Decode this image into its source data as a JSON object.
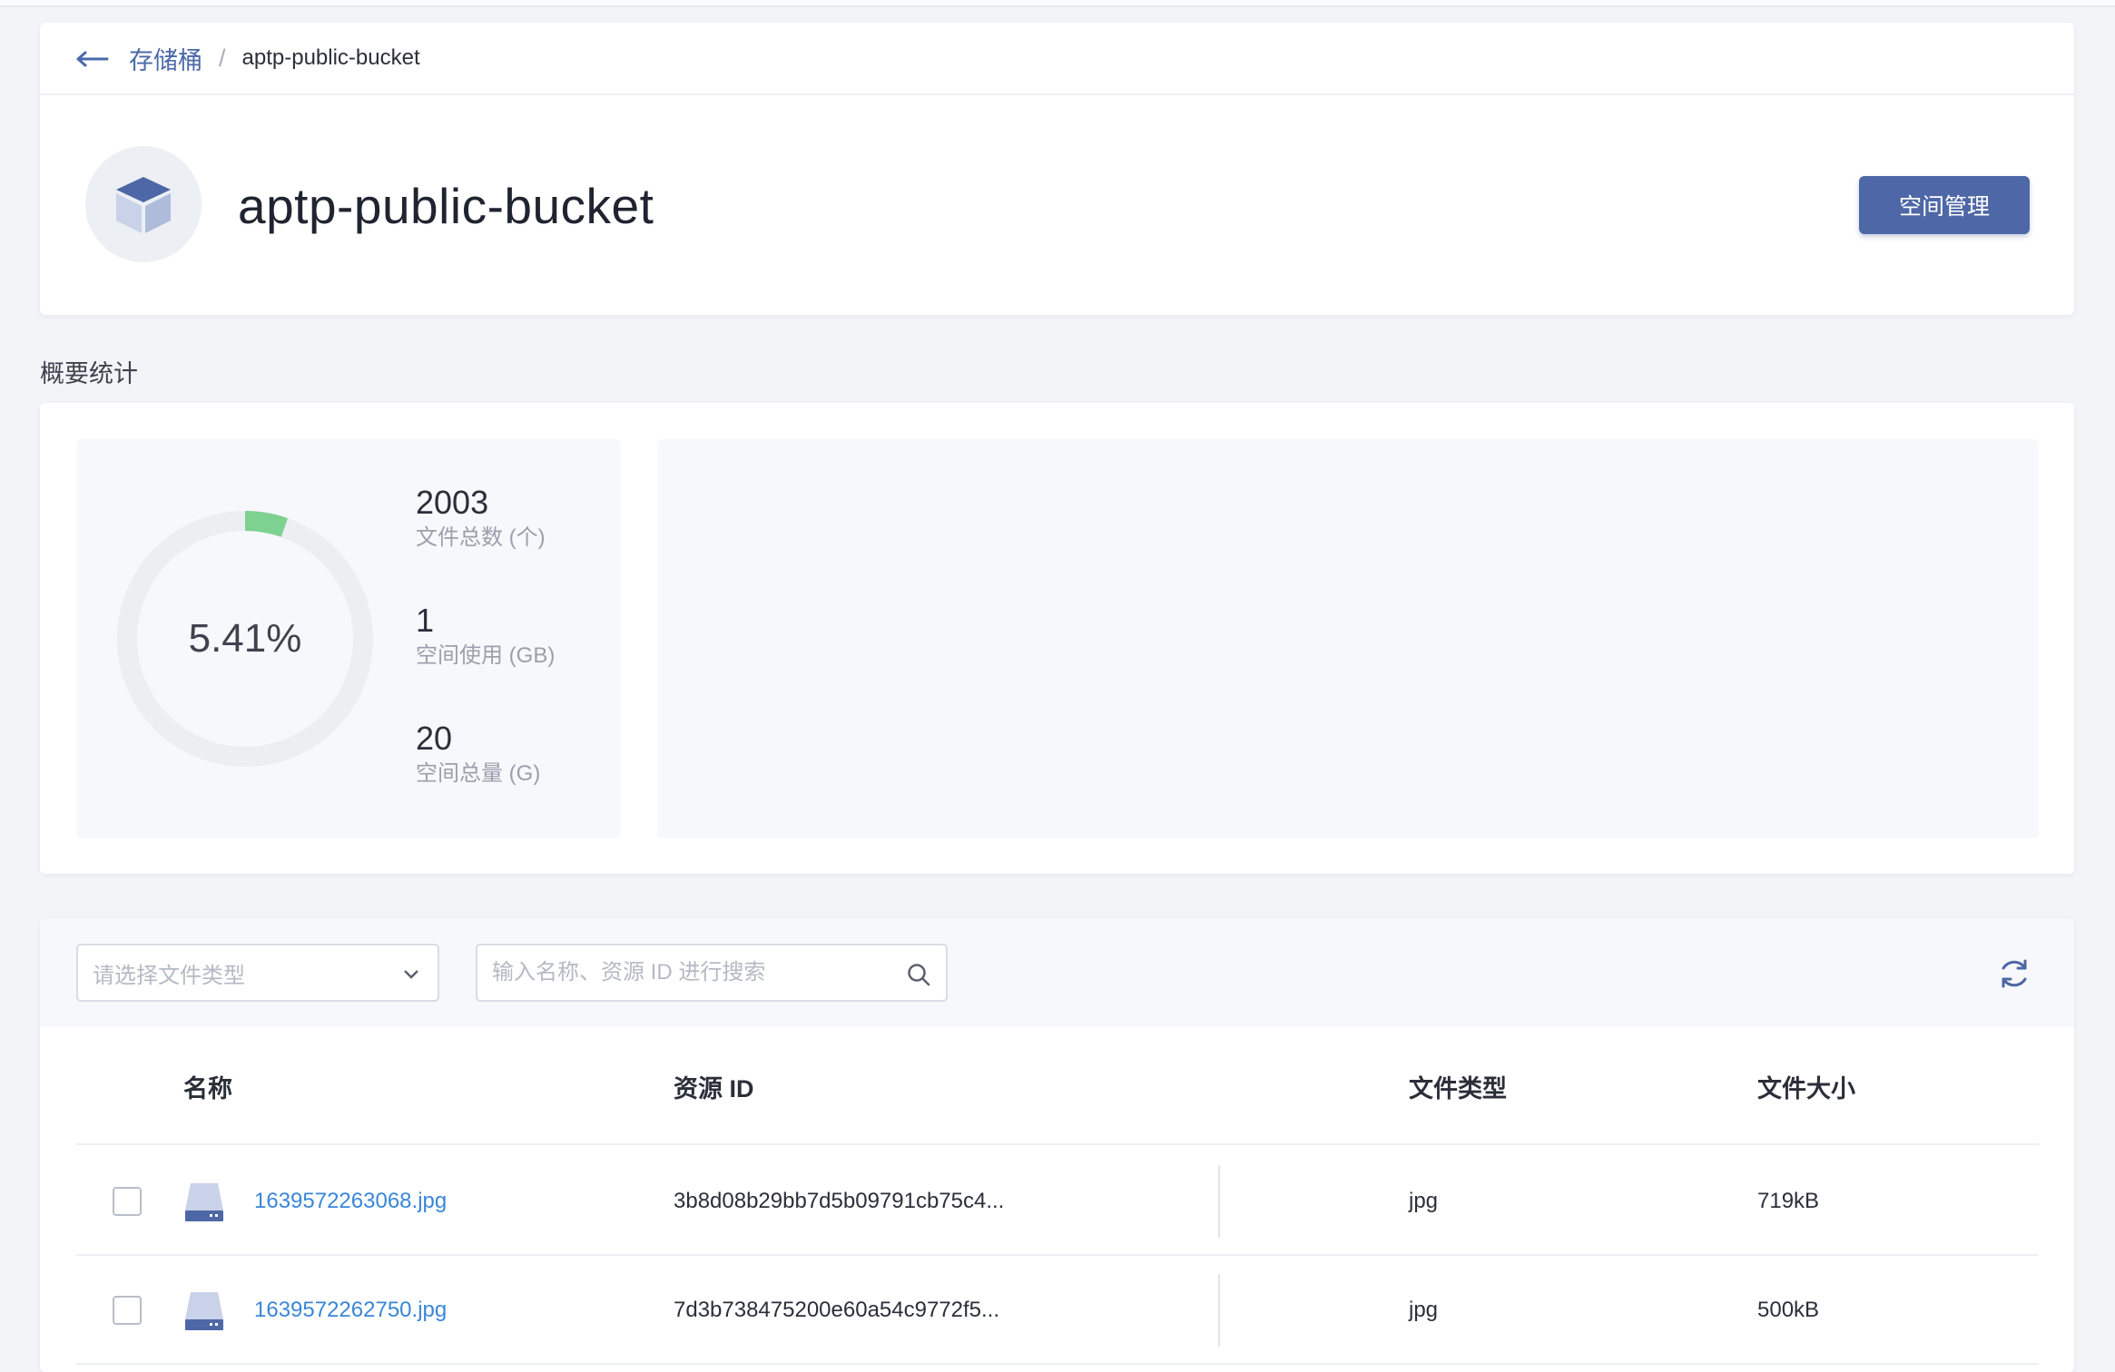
{
  "breadcrumb": {
    "back_icon": "arrow-left-icon",
    "parent": "存储桶",
    "separator": "/",
    "current": "aptp-public-bucket"
  },
  "header": {
    "title": "aptp-public-bucket",
    "logo_icon": "cube-icon",
    "manage_button": "空间管理"
  },
  "summary": {
    "section_title": "概要统计",
    "usage_percent_label": "5.41%",
    "usage_fraction": 0.0541,
    "ring_color": "#7dd191",
    "stats": [
      {
        "value": "2003",
        "label": "文件总数 (个)"
      },
      {
        "value": "1",
        "label": "空间使用 (GB)"
      },
      {
        "value": "20",
        "label": "空间总量 (G)"
      }
    ]
  },
  "filters": {
    "type_select_placeholder": "请选择文件类型",
    "search_placeholder": "输入名称、资源 ID 进行搜索",
    "search_icon": "search-icon",
    "refresh_icon": "refresh-icon"
  },
  "table": {
    "columns": {
      "name": "名称",
      "resource_id": "资源 ID",
      "file_type": "文件类型",
      "file_size": "文件大小"
    },
    "rows": [
      {
        "name": "1639572263068.jpg",
        "resource_id": "3b8d08b29bb7d5b09791cb75c4...",
        "file_type": "jpg",
        "file_size": "719kB",
        "icon": "file-drive-icon"
      },
      {
        "name": "1639572262750.jpg",
        "resource_id": "7d3b738475200e60a54c9772f5...",
        "file_type": "jpg",
        "file_size": "500kB",
        "icon": "file-drive-icon"
      }
    ]
  },
  "colors": {
    "accent": "#4e67a6",
    "link": "#3a86d8",
    "ring_track": "#eceef2",
    "ring_fill": "#7dd191"
  }
}
